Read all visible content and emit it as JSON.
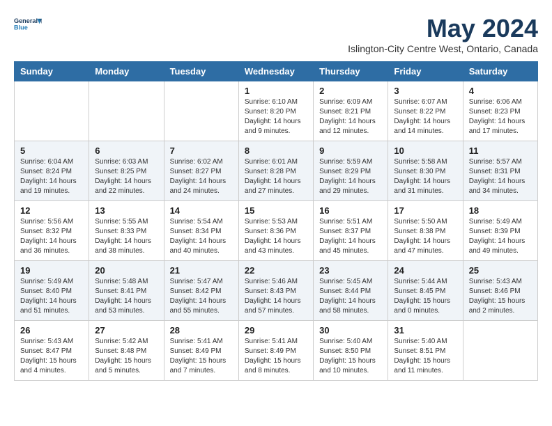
{
  "header": {
    "logo_line1": "General",
    "logo_line2": "Blue",
    "month_title": "May 2024",
    "location": "Islington-City Centre West, Ontario, Canada"
  },
  "days_of_week": [
    "Sunday",
    "Monday",
    "Tuesday",
    "Wednesday",
    "Thursday",
    "Friday",
    "Saturday"
  ],
  "weeks": [
    [
      {
        "day": "",
        "info": ""
      },
      {
        "day": "",
        "info": ""
      },
      {
        "day": "",
        "info": ""
      },
      {
        "day": "1",
        "info": "Sunrise: 6:10 AM\nSunset: 8:20 PM\nDaylight: 14 hours\nand 9 minutes."
      },
      {
        "day": "2",
        "info": "Sunrise: 6:09 AM\nSunset: 8:21 PM\nDaylight: 14 hours\nand 12 minutes."
      },
      {
        "day": "3",
        "info": "Sunrise: 6:07 AM\nSunset: 8:22 PM\nDaylight: 14 hours\nand 14 minutes."
      },
      {
        "day": "4",
        "info": "Sunrise: 6:06 AM\nSunset: 8:23 PM\nDaylight: 14 hours\nand 17 minutes."
      }
    ],
    [
      {
        "day": "5",
        "info": "Sunrise: 6:04 AM\nSunset: 8:24 PM\nDaylight: 14 hours\nand 19 minutes."
      },
      {
        "day": "6",
        "info": "Sunrise: 6:03 AM\nSunset: 8:25 PM\nDaylight: 14 hours\nand 22 minutes."
      },
      {
        "day": "7",
        "info": "Sunrise: 6:02 AM\nSunset: 8:27 PM\nDaylight: 14 hours\nand 24 minutes."
      },
      {
        "day": "8",
        "info": "Sunrise: 6:01 AM\nSunset: 8:28 PM\nDaylight: 14 hours\nand 27 minutes."
      },
      {
        "day": "9",
        "info": "Sunrise: 5:59 AM\nSunset: 8:29 PM\nDaylight: 14 hours\nand 29 minutes."
      },
      {
        "day": "10",
        "info": "Sunrise: 5:58 AM\nSunset: 8:30 PM\nDaylight: 14 hours\nand 31 minutes."
      },
      {
        "day": "11",
        "info": "Sunrise: 5:57 AM\nSunset: 8:31 PM\nDaylight: 14 hours\nand 34 minutes."
      }
    ],
    [
      {
        "day": "12",
        "info": "Sunrise: 5:56 AM\nSunset: 8:32 PM\nDaylight: 14 hours\nand 36 minutes."
      },
      {
        "day": "13",
        "info": "Sunrise: 5:55 AM\nSunset: 8:33 PM\nDaylight: 14 hours\nand 38 minutes."
      },
      {
        "day": "14",
        "info": "Sunrise: 5:54 AM\nSunset: 8:34 PM\nDaylight: 14 hours\nand 40 minutes."
      },
      {
        "day": "15",
        "info": "Sunrise: 5:53 AM\nSunset: 8:36 PM\nDaylight: 14 hours\nand 43 minutes."
      },
      {
        "day": "16",
        "info": "Sunrise: 5:51 AM\nSunset: 8:37 PM\nDaylight: 14 hours\nand 45 minutes."
      },
      {
        "day": "17",
        "info": "Sunrise: 5:50 AM\nSunset: 8:38 PM\nDaylight: 14 hours\nand 47 minutes."
      },
      {
        "day": "18",
        "info": "Sunrise: 5:49 AM\nSunset: 8:39 PM\nDaylight: 14 hours\nand 49 minutes."
      }
    ],
    [
      {
        "day": "19",
        "info": "Sunrise: 5:49 AM\nSunset: 8:40 PM\nDaylight: 14 hours\nand 51 minutes."
      },
      {
        "day": "20",
        "info": "Sunrise: 5:48 AM\nSunset: 8:41 PM\nDaylight: 14 hours\nand 53 minutes."
      },
      {
        "day": "21",
        "info": "Sunrise: 5:47 AM\nSunset: 8:42 PM\nDaylight: 14 hours\nand 55 minutes."
      },
      {
        "day": "22",
        "info": "Sunrise: 5:46 AM\nSunset: 8:43 PM\nDaylight: 14 hours\nand 57 minutes."
      },
      {
        "day": "23",
        "info": "Sunrise: 5:45 AM\nSunset: 8:44 PM\nDaylight: 14 hours\nand 58 minutes."
      },
      {
        "day": "24",
        "info": "Sunrise: 5:44 AM\nSunset: 8:45 PM\nDaylight: 15 hours\nand 0 minutes."
      },
      {
        "day": "25",
        "info": "Sunrise: 5:43 AM\nSunset: 8:46 PM\nDaylight: 15 hours\nand 2 minutes."
      }
    ],
    [
      {
        "day": "26",
        "info": "Sunrise: 5:43 AM\nSunset: 8:47 PM\nDaylight: 15 hours\nand 4 minutes."
      },
      {
        "day": "27",
        "info": "Sunrise: 5:42 AM\nSunset: 8:48 PM\nDaylight: 15 hours\nand 5 minutes."
      },
      {
        "day": "28",
        "info": "Sunrise: 5:41 AM\nSunset: 8:49 PM\nDaylight: 15 hours\nand 7 minutes."
      },
      {
        "day": "29",
        "info": "Sunrise: 5:41 AM\nSunset: 8:49 PM\nDaylight: 15 hours\nand 8 minutes."
      },
      {
        "day": "30",
        "info": "Sunrise: 5:40 AM\nSunset: 8:50 PM\nDaylight: 15 hours\nand 10 minutes."
      },
      {
        "day": "31",
        "info": "Sunrise: 5:40 AM\nSunset: 8:51 PM\nDaylight: 15 hours\nand 11 minutes."
      },
      {
        "day": "",
        "info": ""
      }
    ]
  ]
}
